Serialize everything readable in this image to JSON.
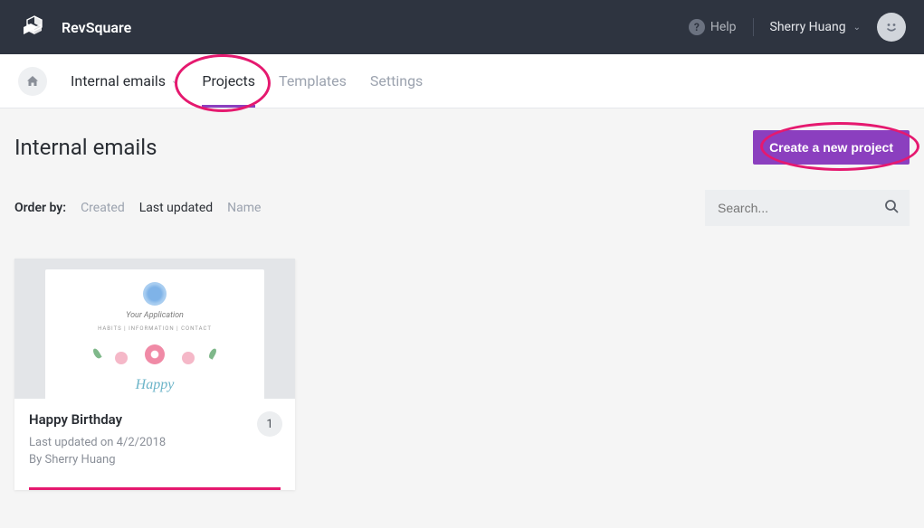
{
  "topbar": {
    "brand": "RevSquare",
    "help": "Help",
    "user": "Sherry Huang"
  },
  "nav": {
    "breadcrumb": "Internal emails",
    "items": [
      "Projects",
      "Templates",
      "Settings"
    ],
    "active_index": 0
  },
  "page": {
    "title": "Internal emails",
    "create_button": "Create a new project"
  },
  "order": {
    "label": "Order by:",
    "options": [
      "Created",
      "Last updated",
      "Name"
    ],
    "active_index": 1
  },
  "search": {
    "placeholder": "Search..."
  },
  "cards": [
    {
      "title": "Happy Birthday",
      "updated": "Last updated on 4/2/2018",
      "by": "By Sherry Huang",
      "count": "1",
      "preview": {
        "app_title": "Your Application",
        "subline": "HABITS | INFORMATION | CONTACT",
        "word": "Happy"
      }
    }
  ]
}
